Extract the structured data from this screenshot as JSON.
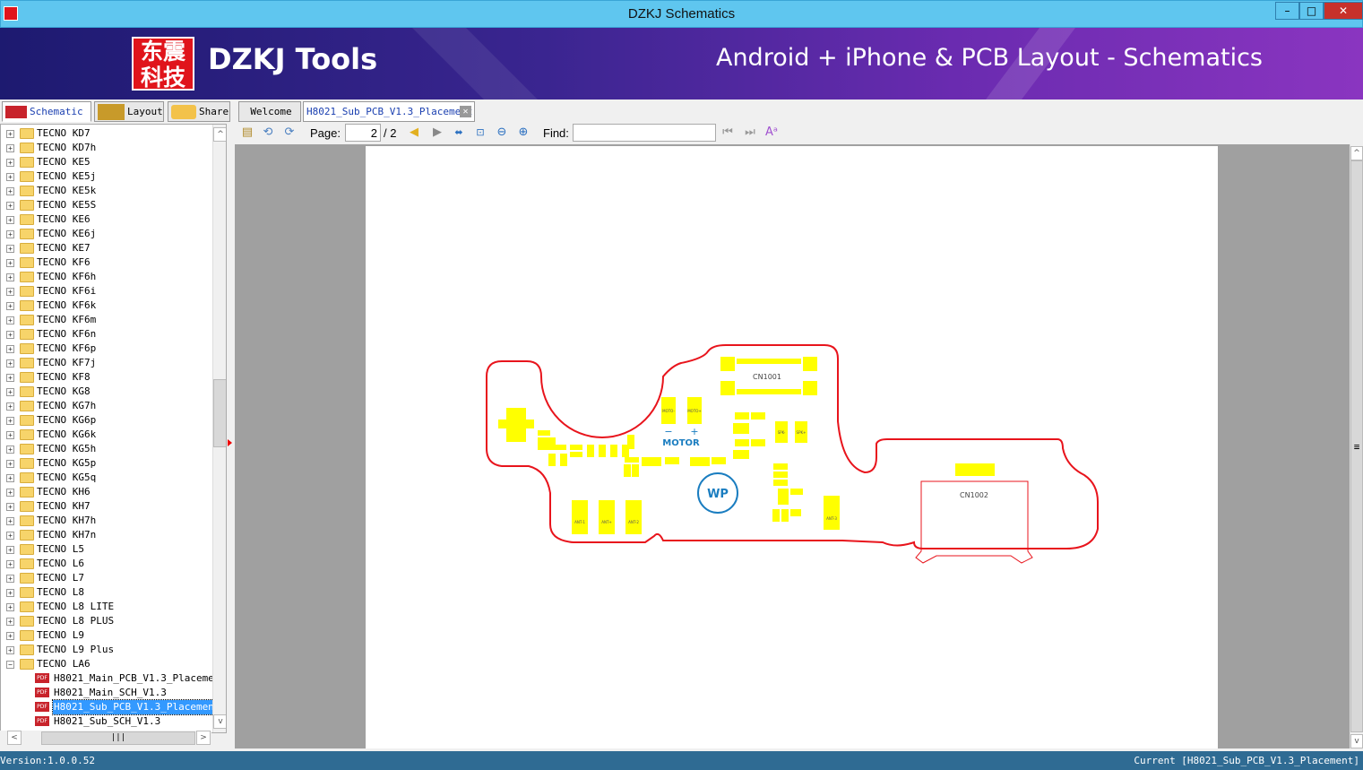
{
  "window": {
    "title": "DZKJ Schematics",
    "controls": [
      "minimize",
      "maximize",
      "close"
    ]
  },
  "banner": {
    "logo_text": "东震科技",
    "brand": "DZKJ Tools",
    "slogan": "Android + iPhone & PCB Layout - Schematics"
  },
  "left_tabs": [
    {
      "label": "Schematic",
      "icon": "pdf-icon"
    },
    {
      "label": "Layout",
      "icon": "pads-icon"
    },
    {
      "label": "Share",
      "icon": "cloud-folder-icon"
    }
  ],
  "doc_tabs": [
    {
      "label": "Welcome"
    },
    {
      "label": "H8021_Sub_PCB_V1.3_Placement",
      "active": true
    }
  ],
  "toolbar": {
    "page_label": "Page:",
    "page_value": "2",
    "page_total": "/ 2",
    "find_label": "Find:",
    "find_value": ""
  },
  "tree": {
    "folders": [
      "TECNO KD7",
      "TECNO KD7h",
      "TECNO KE5",
      "TECNO KE5j",
      "TECNO KE5k",
      "TECNO KE5S",
      "TECNO KE6",
      "TECNO KE6j",
      "TECNO KE7",
      "TECNO KF6",
      "TECNO KF6h",
      "TECNO KF6i",
      "TECNO KF6k",
      "TECNO KF6m",
      "TECNO KF6n",
      "TECNO KF6p",
      "TECNO KF7j",
      "TECNO KF8",
      "TECNO KG8",
      "TECNO KG7h",
      "TECNO KG6p",
      "TECNO KG6k",
      "TECNO KG5h",
      "TECNO KG5p",
      "TECNO KG5q",
      "TECNO KH6",
      "TECNO KH7",
      "TECNO KH7h",
      "TECNO KH7n",
      "TECNO L5",
      "TECNO L6",
      "TECNO L7",
      "TECNO L8",
      "TECNO L8 LITE",
      "TECNO L8 PLUS",
      "TECNO L9",
      "TECNO L9 Plus"
    ],
    "expanded": {
      "label": "TECNO LA6",
      "files": [
        "H8021_Main_PCB_V1.3_Placement",
        "H8021_Main_SCH_V1.3",
        "H8021_Sub_PCB_V1.3_Placement",
        "H8021_Sub_SCH_V1.3"
      ],
      "selected_index": 2
    }
  },
  "pcb": {
    "labels": {
      "cn1": "CN1001",
      "cn2": "CN1002",
      "motor": "MOTOR",
      "motor_minus": "−",
      "motor_plus": "+",
      "wp": "WP",
      "moto_n": "MOTO-",
      "moto_p": "MOTO+",
      "spk_n": "SPK-",
      "spk_p": "SPK+",
      "ant1": "ANT-1",
      "ant2": "ANT+",
      "ant3": "ANT-2",
      "ant4": "ANT-3"
    },
    "outline_color": "#e8141c",
    "pad_color": "#ffff00",
    "accent_color": "#1a7dc0"
  },
  "status": {
    "version": "Version:1.0.0.52",
    "current": "Current [H8021_Sub_PCB_V1.3_Placement]"
  }
}
